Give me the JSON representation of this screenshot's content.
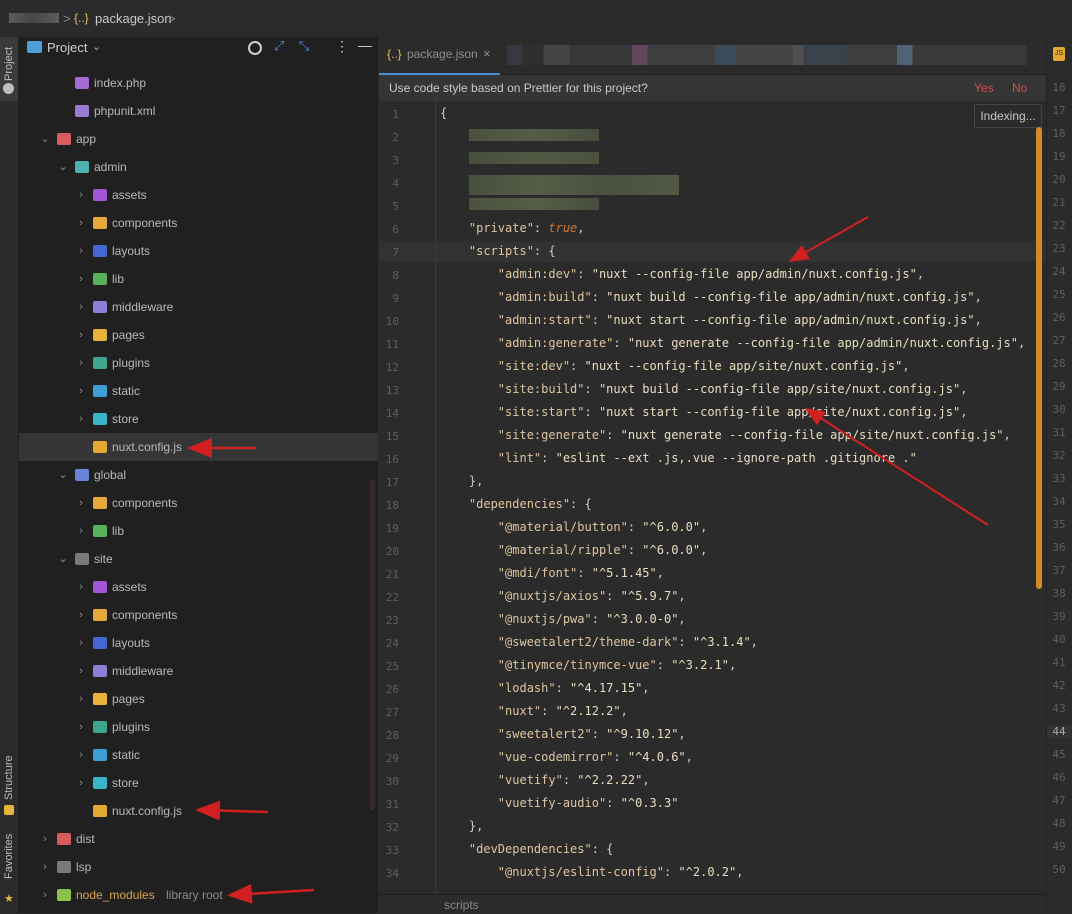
{
  "breadcrumb": {
    "file_icon": "{..}",
    "file": "package.json",
    "sep": ">"
  },
  "sidebar_stripe": {
    "project": "Project",
    "structure": "Structure",
    "favorites": "Favorites"
  },
  "project_panel": {
    "title": "Project",
    "tree": [
      {
        "label": "index.php",
        "indent": 2,
        "icon": "php-icon",
        "chev": "",
        "color": "#a46bd1"
      },
      {
        "label": "phpunit.xml",
        "indent": 2,
        "icon": "xml-icon",
        "chev": "",
        "color": "#9b7bd1"
      },
      {
        "label": "app",
        "indent": 1,
        "icon": "folder-icon",
        "chev": "v",
        "color": "#d85c5c"
      },
      {
        "label": "admin",
        "indent": 2,
        "icon": "folder-icon",
        "chev": "v",
        "color": "#4fb1b1"
      },
      {
        "label": "assets",
        "indent": 3,
        "icon": "folder-icon",
        "chev": ">",
        "color": "#a256d8"
      },
      {
        "label": "components",
        "indent": 3,
        "icon": "folder-icon",
        "chev": ">",
        "color": "#e8a93b"
      },
      {
        "label": "layouts",
        "indent": 3,
        "icon": "folder-icon",
        "chev": ">",
        "color": "#4666d4"
      },
      {
        "label": "lib",
        "indent": 3,
        "icon": "folder-icon",
        "chev": ">",
        "color": "#59b05b"
      },
      {
        "label": "middleware",
        "indent": 3,
        "icon": "folder-icon",
        "chev": ">",
        "color": "#8d7ed8"
      },
      {
        "label": "pages",
        "indent": 3,
        "icon": "folder-icon",
        "chev": ">",
        "color": "#e8b23b"
      },
      {
        "label": "plugins",
        "indent": 3,
        "icon": "folder-icon",
        "chev": ">",
        "color": "#3ea68d"
      },
      {
        "label": "static",
        "indent": 3,
        "icon": "folder-icon",
        "chev": ">",
        "color": "#3b9fd4"
      },
      {
        "label": "store",
        "indent": 3,
        "icon": "folder-icon",
        "chev": ">",
        "color": "#3ab4c8"
      },
      {
        "label": "nuxt.config.js",
        "indent": 3,
        "icon": "js-file-icon",
        "chev": "",
        "color": "#e3a82f",
        "selected": true
      },
      {
        "label": "global",
        "indent": 2,
        "icon": "folder-icon",
        "chev": "v",
        "color": "#6a82d8"
      },
      {
        "label": "components",
        "indent": 3,
        "icon": "folder-icon",
        "chev": ">",
        "color": "#e8a93b"
      },
      {
        "label": "lib",
        "indent": 3,
        "icon": "folder-icon",
        "chev": ">",
        "color": "#59b05b"
      },
      {
        "label": "site",
        "indent": 2,
        "icon": "folder-icon",
        "chev": "v",
        "color": "#7a7a7a"
      },
      {
        "label": "assets",
        "indent": 3,
        "icon": "folder-icon",
        "chev": ">",
        "color": "#a256d8"
      },
      {
        "label": "components",
        "indent": 3,
        "icon": "folder-icon",
        "chev": ">",
        "color": "#e8a93b"
      },
      {
        "label": "layouts",
        "indent": 3,
        "icon": "folder-icon",
        "chev": ">",
        "color": "#4666d4"
      },
      {
        "label": "middleware",
        "indent": 3,
        "icon": "folder-icon",
        "chev": ">",
        "color": "#8d7ed8"
      },
      {
        "label": "pages",
        "indent": 3,
        "icon": "folder-icon",
        "chev": ">",
        "color": "#e8b23b"
      },
      {
        "label": "plugins",
        "indent": 3,
        "icon": "folder-icon",
        "chev": ">",
        "color": "#3ea68d"
      },
      {
        "label": "static",
        "indent": 3,
        "icon": "folder-icon",
        "chev": ">",
        "color": "#3b9fd4"
      },
      {
        "label": "store",
        "indent": 3,
        "icon": "folder-icon",
        "chev": ">",
        "color": "#3ab4c8"
      },
      {
        "label": "nuxt.config.js",
        "indent": 3,
        "icon": "js-file-icon",
        "chev": "",
        "color": "#e3a82f"
      },
      {
        "label": "dist",
        "indent": 1,
        "icon": "folder-icon",
        "chev": ">",
        "color": "#d85c5c"
      },
      {
        "label": "lsp",
        "indent": 1,
        "icon": "folder-icon",
        "chev": ">",
        "color": "#7a7a7a"
      },
      {
        "label": "node_modules",
        "indent": 1,
        "icon": "folder-icon",
        "chev": ">",
        "color": "#8bc34a",
        "sub": "library root",
        "orange": true
      }
    ]
  },
  "editor": {
    "tab_label": "package.json",
    "tab_icon": "{..}",
    "close": "×",
    "prettier_msg": "Use code style based on Prettier for this project?",
    "prettier_yes": "Yes",
    "prettier_no": "No",
    "indexing": "Indexing...",
    "status_path": "scripts",
    "lines": [
      {
        "n": "1",
        "t": [
          [
            "p",
            "{"
          ]
        ]
      },
      {
        "n": "2",
        "t": []
      },
      {
        "n": "3",
        "t": []
      },
      {
        "n": "4",
        "t": []
      },
      {
        "n": "5",
        "t": []
      },
      {
        "n": "6",
        "t": [
          [
            "k",
            "    \"private\""
          ],
          [
            "p",
            ": "
          ],
          [
            "b",
            "true"
          ],
          [
            "p",
            ","
          ]
        ]
      },
      {
        "n": "7",
        "t": [
          [
            "k",
            "    \"scripts\""
          ],
          [
            "p",
            ": {"
          ]
        ]
      },
      {
        "n": "8",
        "t": [
          [
            "k",
            "        \"admin:dev\""
          ],
          [
            "p",
            ": "
          ],
          [
            "s",
            "\"nuxt --config-file app/admin/nuxt.config.js\""
          ],
          [
            "p",
            ","
          ]
        ]
      },
      {
        "n": "9",
        "t": [
          [
            "k",
            "        \"admin:build\""
          ],
          [
            "p",
            ": "
          ],
          [
            "s",
            "\"nuxt build --config-file app/admin/nuxt.config.js\""
          ],
          [
            "p",
            ","
          ]
        ]
      },
      {
        "n": "10",
        "t": [
          [
            "k",
            "        \"admin:start\""
          ],
          [
            "p",
            ": "
          ],
          [
            "s",
            "\"nuxt start --config-file app/admin/nuxt.config.js\""
          ],
          [
            "p",
            ","
          ]
        ]
      },
      {
        "n": "11",
        "t": [
          [
            "k",
            "        \"admin:generate\""
          ],
          [
            "p",
            ": "
          ],
          [
            "s",
            "\"nuxt generate --config-file app/admin/nuxt.config.js\""
          ],
          [
            "p",
            ","
          ]
        ]
      },
      {
        "n": "12",
        "t": [
          [
            "k",
            "        \"site:dev\""
          ],
          [
            "p",
            ": "
          ],
          [
            "s",
            "\"nuxt --config-file app/site/nuxt.config.js\""
          ],
          [
            "p",
            ","
          ]
        ]
      },
      {
        "n": "13",
        "t": [
          [
            "k",
            "        \"site:build\""
          ],
          [
            "p",
            ": "
          ],
          [
            "s",
            "\"nuxt build --config-file app/site/nuxt.config.js\""
          ],
          [
            "p",
            ","
          ]
        ]
      },
      {
        "n": "14",
        "t": [
          [
            "k",
            "        \"site:start\""
          ],
          [
            "p",
            ": "
          ],
          [
            "s",
            "\"nuxt start --config-file app/site/nuxt.config.js\""
          ],
          [
            "p",
            ","
          ]
        ]
      },
      {
        "n": "15",
        "t": [
          [
            "k",
            "        \"site:generate\""
          ],
          [
            "p",
            ": "
          ],
          [
            "s",
            "\"nuxt generate --config-file app/site/nuxt.config.js\""
          ],
          [
            "p",
            ","
          ]
        ]
      },
      {
        "n": "16",
        "t": [
          [
            "k",
            "        \"lint\""
          ],
          [
            "p",
            ": "
          ],
          [
            "s",
            "\"eslint --ext .js,.vue --ignore-path .gitignore .\""
          ]
        ]
      },
      {
        "n": "17",
        "t": [
          [
            "p",
            "    },"
          ]
        ]
      },
      {
        "n": "18",
        "t": [
          [
            "k",
            "    \"dependencies\""
          ],
          [
            "p",
            ": {"
          ]
        ]
      },
      {
        "n": "19",
        "t": [
          [
            "k",
            "        \"@material/button\""
          ],
          [
            "p",
            ": "
          ],
          [
            "s",
            "\"^6.0.0\""
          ],
          [
            "p",
            ","
          ]
        ]
      },
      {
        "n": "20",
        "t": [
          [
            "k",
            "        \"@material/ripple\""
          ],
          [
            "p",
            ": "
          ],
          [
            "s",
            "\"^6.0.0\""
          ],
          [
            "p",
            ","
          ]
        ]
      },
      {
        "n": "21",
        "t": [
          [
            "k",
            "        \"@mdi/font\""
          ],
          [
            "p",
            ": "
          ],
          [
            "s",
            "\"^5.1.45\""
          ],
          [
            "p",
            ","
          ]
        ]
      },
      {
        "n": "22",
        "t": [
          [
            "k",
            "        \"@nuxtjs/axios\""
          ],
          [
            "p",
            ": "
          ],
          [
            "s",
            "\"^5.9.7\""
          ],
          [
            "p",
            ","
          ]
        ]
      },
      {
        "n": "23",
        "t": [
          [
            "k",
            "        \"@nuxtjs/pwa\""
          ],
          [
            "p",
            ": "
          ],
          [
            "s",
            "\"^3.0.0-0\""
          ],
          [
            "p",
            ","
          ]
        ]
      },
      {
        "n": "24",
        "t": [
          [
            "k",
            "        \"@sweetalert2/theme-dark\""
          ],
          [
            "p",
            ": "
          ],
          [
            "s",
            "\"^3.1.4\""
          ],
          [
            "p",
            ","
          ]
        ]
      },
      {
        "n": "25",
        "t": [
          [
            "k",
            "        \"@tinymce/tinymce-vue\""
          ],
          [
            "p",
            ": "
          ],
          [
            "s",
            "\"^3.2.1\""
          ],
          [
            "p",
            ","
          ]
        ]
      },
      {
        "n": "26",
        "t": [
          [
            "k",
            "        \"lodash\""
          ],
          [
            "p",
            ": "
          ],
          [
            "s",
            "\"^4.17.15\""
          ],
          [
            "p",
            ","
          ]
        ]
      },
      {
        "n": "27",
        "t": [
          [
            "k",
            "        \"nuxt\""
          ],
          [
            "p",
            ": "
          ],
          [
            "s",
            "\"^2.12.2\""
          ],
          [
            "p",
            ","
          ]
        ]
      },
      {
        "n": "28",
        "t": [
          [
            "k",
            "        \"sweetalert2\""
          ],
          [
            "p",
            ": "
          ],
          [
            "s",
            "\"^9.10.12\""
          ],
          [
            "p",
            ","
          ]
        ]
      },
      {
        "n": "29",
        "t": [
          [
            "k",
            "        \"vue-codemirror\""
          ],
          [
            "p",
            ": "
          ],
          [
            "s",
            "\"^4.0.6\""
          ],
          [
            "p",
            ","
          ]
        ]
      },
      {
        "n": "30",
        "t": [
          [
            "k",
            "        \"vuetify\""
          ],
          [
            "p",
            ": "
          ],
          [
            "s",
            "\"^2.2.22\""
          ],
          [
            "p",
            ","
          ]
        ]
      },
      {
        "n": "31",
        "t": [
          [
            "k",
            "        \"vuetify-audio\""
          ],
          [
            "p",
            ": "
          ],
          [
            "s",
            "\"^0.3.3\""
          ]
        ]
      },
      {
        "n": "32",
        "t": [
          [
            "p",
            "    },"
          ]
        ]
      },
      {
        "n": "33",
        "t": [
          [
            "k",
            "    \"devDependencies\""
          ],
          [
            "p",
            ": {"
          ]
        ]
      },
      {
        "n": "34",
        "t": [
          [
            "k",
            "        \"@nuxtjs/eslint-config\""
          ],
          [
            "p",
            ": "
          ],
          [
            "s",
            "\"^2.0.2\""
          ],
          [
            "p",
            ","
          ]
        ]
      }
    ]
  },
  "right_gutter": [
    "16",
    "17",
    "18",
    "19",
    "20",
    "21",
    "22",
    "23",
    "24",
    "25",
    "26",
    "27",
    "28",
    "29",
    "30",
    "31",
    "32",
    "33",
    "34",
    "35",
    "36",
    "37",
    "38",
    "39",
    "40",
    "41",
    "42",
    "43",
    "44",
    "45",
    "46",
    "47",
    "48",
    "49",
    "50"
  ],
  "colors": {
    "accent": "#4b8cd6",
    "prettier_action": "#d64f4f",
    "arrow": "#d22020",
    "scroll": "#d08a2a"
  }
}
